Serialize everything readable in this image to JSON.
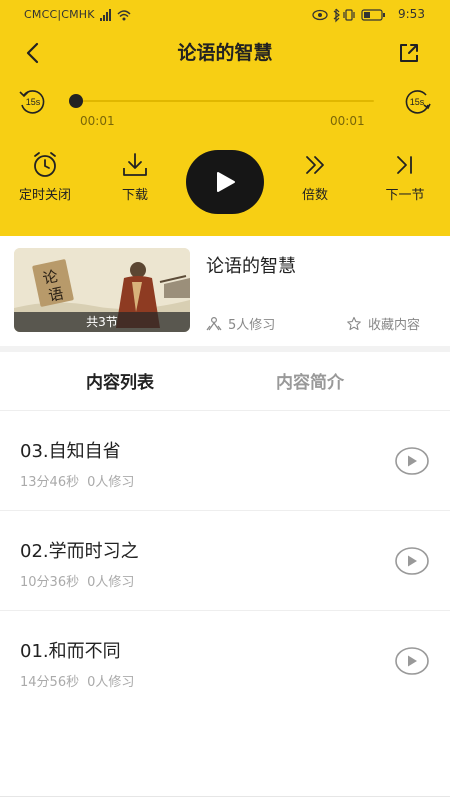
{
  "status_bar": {
    "carrier": "CMCC|CMHK",
    "time": "9:53"
  },
  "header": {
    "title": "论语的智慧"
  },
  "player": {
    "rewind_label": "15s",
    "forward_label": "15s",
    "current_time": "00:01",
    "total_time": "00:01",
    "progress": 0.0
  },
  "controls": {
    "timer_label": "定时关闭",
    "download_label": "下载",
    "speed_label": "倍数",
    "next_label": "下一节"
  },
  "course": {
    "title": "论语的智慧",
    "sections_caption": "共3节",
    "learners": "5人修习",
    "favorite_label": "收藏内容"
  },
  "tabs": [
    {
      "label": "内容列表",
      "active": true
    },
    {
      "label": "内容简介",
      "active": false
    }
  ],
  "items": [
    {
      "title": "03.自知自省",
      "duration": "13分46秒",
      "learners": "0人修习"
    },
    {
      "title": "02.学而时习之",
      "duration": "10分36秒",
      "learners": "0人修习"
    },
    {
      "title": "01.和而不同",
      "duration": "14分56秒",
      "learners": "0人修习"
    }
  ],
  "colors": {
    "brand_yellow": "#f7cf14",
    "dark": "#161616",
    "muted": "#aaaaaa"
  }
}
